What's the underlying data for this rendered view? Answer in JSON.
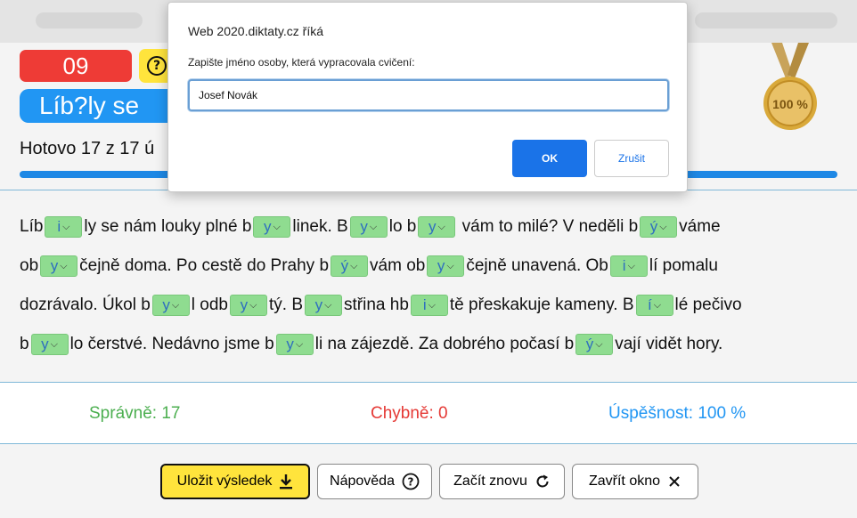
{
  "exercise": {
    "number": "09",
    "title": "Líb?ly se",
    "progress_text": "Hotovo 17 z 17 ú",
    "progress_fraction": 1.0
  },
  "medal": {
    "label": "100 %"
  },
  "text_lines": [
    [
      {
        "t": "text",
        "v": "Líb"
      },
      {
        "t": "gap",
        "v": "i"
      },
      {
        "t": "text",
        "v": "ly se nám louky plné b"
      },
      {
        "t": "gap",
        "v": "y"
      },
      {
        "t": "text",
        "v": "linek. B"
      },
      {
        "t": "gap",
        "v": "y"
      },
      {
        "t": "text",
        "v": "lo b"
      },
      {
        "t": "gap",
        "v": "y"
      },
      {
        "t": "text",
        "v": " vám to milé? V neděli b"
      },
      {
        "t": "gap",
        "v": "ý"
      },
      {
        "t": "text",
        "v": "váme"
      }
    ],
    [
      {
        "t": "text",
        "v": "ob"
      },
      {
        "t": "gap",
        "v": "y"
      },
      {
        "t": "text",
        "v": "čejně doma. Po cestě do Prahy b"
      },
      {
        "t": "gap",
        "v": "ý"
      },
      {
        "t": "text",
        "v": "vám ob"
      },
      {
        "t": "gap",
        "v": "y"
      },
      {
        "t": "text",
        "v": "čejně unavená. Ob"
      },
      {
        "t": "gap",
        "v": "i"
      },
      {
        "t": "text",
        "v": "lí pomalu"
      }
    ],
    [
      {
        "t": "text",
        "v": "dozrávalo. Úkol b"
      },
      {
        "t": "gap",
        "v": "y"
      },
      {
        "t": "text",
        "v": "l odb"
      },
      {
        "t": "gap",
        "v": "y"
      },
      {
        "t": "text",
        "v": "tý. B"
      },
      {
        "t": "gap",
        "v": "y"
      },
      {
        "t": "text",
        "v": "střina hb"
      },
      {
        "t": "gap",
        "v": "i"
      },
      {
        "t": "text",
        "v": "tě přeskakuje kameny. B"
      },
      {
        "t": "gap",
        "v": "í"
      },
      {
        "t": "text",
        "v": "lé pečivo"
      }
    ],
    [
      {
        "t": "text",
        "v": "b"
      },
      {
        "t": "gap",
        "v": "y"
      },
      {
        "t": "text",
        "v": "lo čerstvé. Nedávno jsme b"
      },
      {
        "t": "gap",
        "v": "y"
      },
      {
        "t": "text",
        "v": "li na zájezdě. Za dobrého počasí b"
      },
      {
        "t": "gap",
        "v": "ý"
      },
      {
        "t": "text",
        "v": "vají vidět hory."
      }
    ]
  ],
  "stats": {
    "correct": "Správně: 17",
    "wrong": "Chybně: 0",
    "success": "Úspěšnost: 100 %"
  },
  "buttons": {
    "save": "Uložit výsledek",
    "help": "Nápověda",
    "restart": "Začít znovu",
    "close": "Zavřít okno"
  },
  "dialog": {
    "title": "Web 2020.diktaty.cz říká",
    "message": "Zapište jméno osoby, která vypracovala cvičení:",
    "input_value": "Josef Novák",
    "ok_label": "OK",
    "cancel_label": "Zrušit"
  },
  "colors": {
    "badge_red": "#ee3b36",
    "help_yellow": "#ffe43c",
    "title_blue": "#2196f3",
    "gap_green": "#8fdc90",
    "ok_blue": "#1a73e8"
  },
  "icons": {
    "help": "question-circle-icon",
    "download": "download-icon",
    "restart": "refresh-icon",
    "close": "close-icon",
    "medal": "medal-icon",
    "chevron": "chevron-down-icon"
  }
}
